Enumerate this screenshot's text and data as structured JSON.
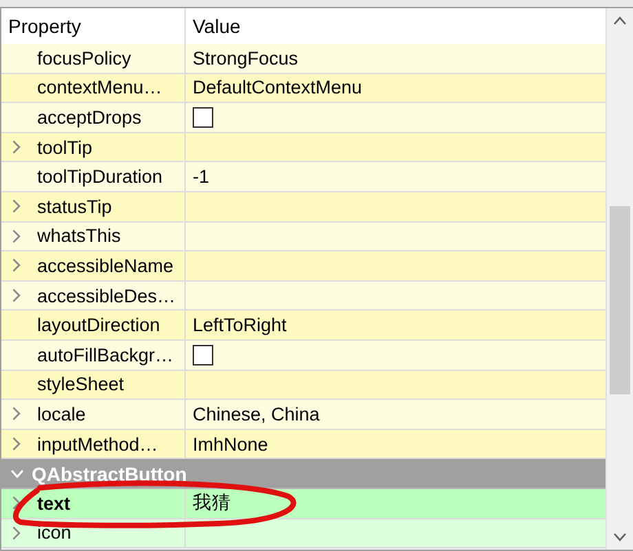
{
  "header": {
    "property": "Property",
    "value": "Value"
  },
  "rows": [
    {
      "name": "focusPolicy",
      "kind": "text",
      "value": "StrongFocus",
      "expandable": false
    },
    {
      "name": "contextMenu…",
      "kind": "text",
      "value": "DefaultContextMenu",
      "expandable": false
    },
    {
      "name": "acceptDrops",
      "kind": "checkbox",
      "checked": false,
      "expandable": false
    },
    {
      "name": "toolTip",
      "kind": "text",
      "expandable": true
    },
    {
      "name": "toolTipDuration",
      "kind": "text",
      "value": "-1",
      "expandable": false
    },
    {
      "name": "statusTip",
      "kind": "text",
      "expandable": true
    },
    {
      "name": "whatsThis",
      "kind": "text",
      "expandable": true
    },
    {
      "name": "accessibleName",
      "kind": "text",
      "expandable": true
    },
    {
      "name": "accessibleDes…",
      "kind": "text",
      "expandable": true
    },
    {
      "name": "layoutDirection",
      "kind": "text",
      "value": "LeftToRight",
      "expandable": false
    },
    {
      "name": "autoFillBackgr…",
      "kind": "checkbox",
      "checked": false,
      "expandable": false
    },
    {
      "name": "styleSheet",
      "kind": "text",
      "expandable": false
    },
    {
      "name": "locale",
      "kind": "text",
      "value": "Chinese, China",
      "expandable": true
    },
    {
      "name": "inputMethod…",
      "kind": "text",
      "value": "ImhNone",
      "expandable": true
    }
  ],
  "groups": [
    {
      "name": "QAbstractButton",
      "expanded": true,
      "rows": [
        {
          "name": "text",
          "kind": "text",
          "value": "我猜",
          "expandable": true,
          "modified": true,
          "circled": true
        },
        {
          "name": "icon",
          "kind": "text",
          "expandable": true,
          "modified": false,
          "circled": false
        }
      ]
    }
  ]
}
